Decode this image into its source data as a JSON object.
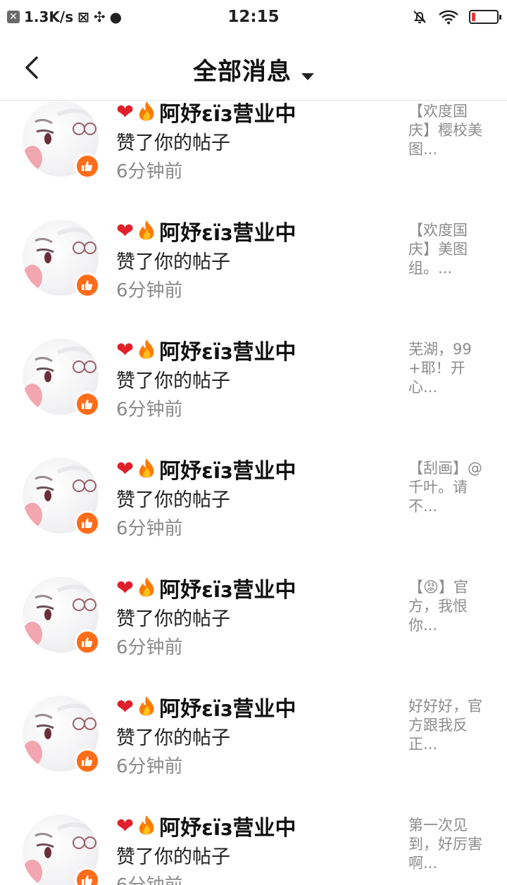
{
  "status_bar": {
    "net_speed": "1.3K/s",
    "time": "12:15",
    "battery_level": 0.15,
    "battery_color": "#e53935"
  },
  "header": {
    "title": "全部消息",
    "back_icon": "chevron-left-icon",
    "dropdown_icon": "caret-down-icon"
  },
  "accent": {
    "like_badge": "#ff6d1a",
    "heart": "#e0202a"
  },
  "notifications": [
    {
      "username": "阿妤εïз营业中",
      "action": "赞了你的帖子",
      "time": "6分钟前",
      "preview": "【欢度国庆】樱校美图..."
    },
    {
      "username": "阿妤εïз营业中",
      "action": "赞了你的帖子",
      "time": "6分钟前",
      "preview": "【欢度国庆】美图组。..."
    },
    {
      "username": "阿妤εïз营业中",
      "action": "赞了你的帖子",
      "time": "6分钟前",
      "preview": "芜湖，99+耶！开心..."
    },
    {
      "username": "阿妤εïз营业中",
      "action": "赞了你的帖子",
      "time": "6分钟前",
      "preview": "【刮画】@千叶。请不..."
    },
    {
      "username": "阿妤εïз营业中",
      "action": "赞了你的帖子",
      "time": "6分钟前",
      "preview": "【😡】官方，我恨你..."
    },
    {
      "username": "阿妤εïз营业中",
      "action": "赞了你的帖子",
      "time": "6分钟前",
      "preview": "好好好，官方跟我反正..."
    },
    {
      "username": "阿妤εïз营业中",
      "action": "赞了你的帖子",
      "time": "6分钟前",
      "preview": "第一次见到，好厉害啊..."
    }
  ]
}
